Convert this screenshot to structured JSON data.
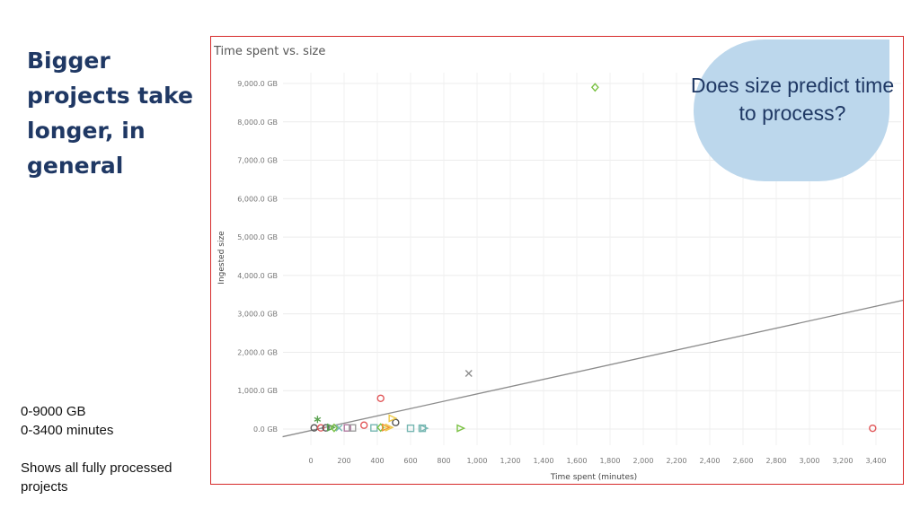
{
  "slide": {
    "headline": "Bigger projects take longer, in general",
    "notes": [
      "0-9000 GB",
      "0-3400 minutes",
      "",
      "Shows all fully processed projects"
    ]
  },
  "callout": {
    "text": "Does size predict time to process?"
  },
  "colors": {
    "headline": "#1f3864",
    "frame": "#d62a2a",
    "callout_fill": "#bcd7ec",
    "trend_line": "#8c8c8c"
  },
  "chart_data": {
    "type": "scatter",
    "title": "Time spent vs. size",
    "xlabel": "Time spent (minutes)",
    "ylabel": "Ingested size",
    "xlim": [
      0,
      3400
    ],
    "ylim": [
      0,
      9000
    ],
    "x_ticks": [
      "0",
      "200",
      "400",
      "600",
      "800",
      "1,000",
      "1,200",
      "1,400",
      "1,600",
      "1,800",
      "2,000",
      "2,200",
      "2,400",
      "2,600",
      "2,800",
      "3,000",
      "3,200",
      "3,400"
    ],
    "y_ticks": [
      "0.0 GB",
      "1,000.0 GB",
      "2,000.0 GB",
      "3,000.0 GB",
      "4,000.0 GB",
      "5,000.0 GB",
      "6,000.0 GB",
      "7,000.0 GB",
      "8,000.0 GB",
      "9,000.0 GB"
    ],
    "grid": true,
    "trend_line": [
      [
        -170,
        -200
      ],
      [
        3570,
        3360
      ]
    ],
    "points": [
      {
        "x": 1710,
        "y": 8900,
        "marker": "diamond",
        "color": "#7ac143"
      },
      {
        "x": 950,
        "y": 1450,
        "marker": "x",
        "color": "#8c8c8c"
      },
      {
        "x": 420,
        "y": 800,
        "marker": "circle",
        "color": "#e15759"
      },
      {
        "x": 3380,
        "y": 20,
        "marker": "circle",
        "color": "#e15759"
      },
      {
        "x": 40,
        "y": 250,
        "marker": "star",
        "color": "#59a14f"
      },
      {
        "x": 510,
        "y": 170,
        "marker": "circle",
        "color": "#555555"
      },
      {
        "x": 320,
        "y": 100,
        "marker": "circle",
        "color": "#e15759"
      },
      {
        "x": 490,
        "y": 280,
        "marker": "triangle",
        "color": "#edc948"
      },
      {
        "x": 900,
        "y": 20,
        "marker": "triangle",
        "color": "#7ac143"
      },
      {
        "x": 600,
        "y": 20,
        "marker": "square",
        "color": "#76b7b2"
      },
      {
        "x": 670,
        "y": 20,
        "marker": "square",
        "color": "#76b7b2"
      },
      {
        "x": 680,
        "y": 20,
        "marker": "triangle",
        "color": "#76b7b2"
      },
      {
        "x": 20,
        "y": 30,
        "marker": "circle",
        "color": "#555555"
      },
      {
        "x": 60,
        "y": 30,
        "marker": "circle",
        "color": "#e15759"
      },
      {
        "x": 90,
        "y": 30,
        "marker": "circle",
        "color": "#555555"
      },
      {
        "x": 120,
        "y": 40,
        "marker": "triangle",
        "color": "#59a14f"
      },
      {
        "x": 140,
        "y": 30,
        "marker": "diamond",
        "color": "#7ac143"
      },
      {
        "x": 170,
        "y": 30,
        "marker": "x",
        "color": "#76b7b2"
      },
      {
        "x": 220,
        "y": 30,
        "marker": "square",
        "color": "#b07aa1"
      },
      {
        "x": 250,
        "y": 30,
        "marker": "square",
        "color": "#9c9c9c"
      },
      {
        "x": 380,
        "y": 30,
        "marker": "square",
        "color": "#76b7b2"
      },
      {
        "x": 420,
        "y": 40,
        "marker": "diamond",
        "color": "#7ac143"
      },
      {
        "x": 450,
        "y": 40,
        "marker": "triangle",
        "color": "#f28e2b"
      },
      {
        "x": 470,
        "y": 40,
        "marker": "triangle",
        "color": "#edc948"
      }
    ]
  }
}
